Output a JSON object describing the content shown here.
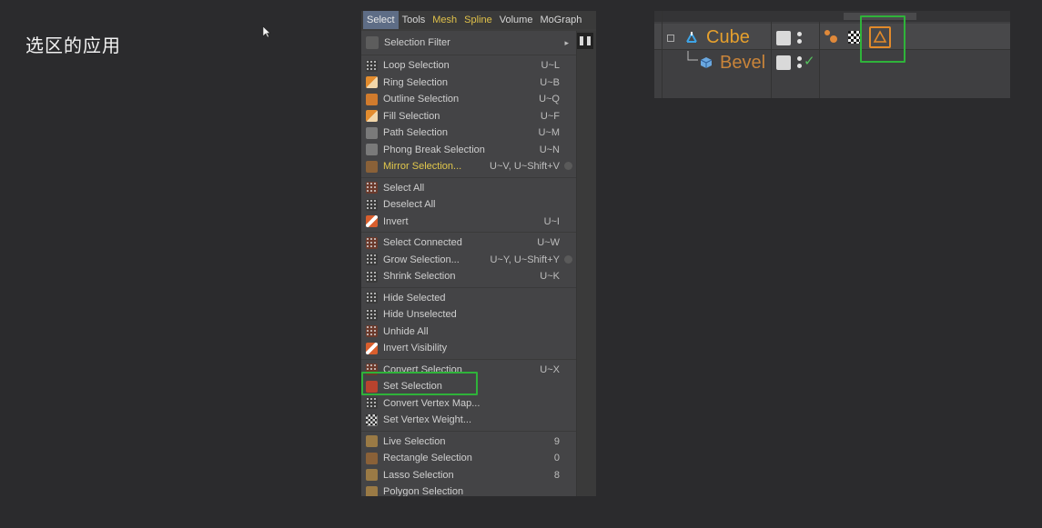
{
  "slide": {
    "title": "选区的应用"
  },
  "menubar": {
    "tabs": [
      "Select",
      "Tools",
      "Mesh",
      "Spline",
      "Volume",
      "MoGraph"
    ]
  },
  "menu": {
    "filter": {
      "label": "Selection Filter",
      "arrow": "▸",
      "icon": "filter-icon"
    },
    "groups": [
      [
        {
          "label": "Loop Selection",
          "shortcut": "U~L",
          "icon": "loop-selection-icon"
        },
        {
          "label": "Ring Selection",
          "shortcut": "U~B",
          "icon": "ring-selection-icon"
        },
        {
          "label": "Outline Selection",
          "shortcut": "U~Q",
          "icon": "outline-selection-icon"
        },
        {
          "label": "Fill Selection",
          "shortcut": "U~F",
          "icon": "fill-selection-icon"
        },
        {
          "label": "Path Selection",
          "shortcut": "U~M",
          "icon": "path-selection-icon"
        },
        {
          "label": "Phong Break Selection",
          "shortcut": "U~N",
          "icon": "phong-break-icon"
        },
        {
          "label": "Mirror Selection...",
          "shortcut": "U~V, U~Shift+V",
          "icon": "mirror-selection-icon",
          "gear": true
        }
      ],
      [
        {
          "label": "Select All",
          "shortcut": "",
          "icon": "select-all-icon"
        },
        {
          "label": "Deselect All",
          "shortcut": "",
          "icon": "deselect-all-icon"
        },
        {
          "label": "Invert",
          "shortcut": "U~I",
          "icon": "invert-icon"
        }
      ],
      [
        {
          "label": "Select Connected",
          "shortcut": "U~W",
          "icon": "select-connected-icon"
        },
        {
          "label": "Grow Selection...",
          "shortcut": "U~Y, U~Shift+Y",
          "icon": "grow-selection-icon",
          "gear": true
        },
        {
          "label": "Shrink Selection",
          "shortcut": "U~K",
          "icon": "shrink-selection-icon"
        }
      ],
      [
        {
          "label": "Hide Selected",
          "shortcut": "",
          "icon": "hide-selected-icon"
        },
        {
          "label": "Hide Unselected",
          "shortcut": "",
          "icon": "hide-unselected-icon"
        },
        {
          "label": "Unhide All",
          "shortcut": "",
          "icon": "unhide-all-icon"
        },
        {
          "label": "Invert Visibility",
          "shortcut": "",
          "icon": "invert-visibility-icon"
        }
      ],
      [
        {
          "label": "Convert Selection",
          "shortcut": "U~X",
          "icon": "convert-selection-icon"
        },
        {
          "label": "Set Selection",
          "shortcut": "",
          "icon": "set-selection-icon"
        },
        {
          "label": "Convert Vertex Map...",
          "shortcut": "",
          "icon": "convert-vertex-map-icon"
        },
        {
          "label": "Set Vertex Weight...",
          "shortcut": "",
          "icon": "set-vertex-weight-icon"
        }
      ],
      [
        {
          "label": "Live Selection",
          "shortcut": "9",
          "icon": "live-selection-icon"
        },
        {
          "label": "Rectangle Selection",
          "shortcut": "0",
          "icon": "rectangle-selection-icon"
        },
        {
          "label": "Lasso Selection",
          "shortcut": "8",
          "icon": "lasso-selection-icon"
        },
        {
          "label": "Polygon Selection",
          "shortcut": "",
          "icon": "polygon-selection-icon"
        }
      ]
    ]
  },
  "object_manager": {
    "objects": [
      {
        "name": "Cube",
        "icon": "cube-primitive-icon"
      },
      {
        "name": "Bevel",
        "icon": "bevel-deformer-icon"
      }
    ]
  },
  "colors": {
    "highlight_box": "#2fb33a",
    "object_name": "#e6a02d",
    "menu_tab_active": "#5e6d86"
  }
}
